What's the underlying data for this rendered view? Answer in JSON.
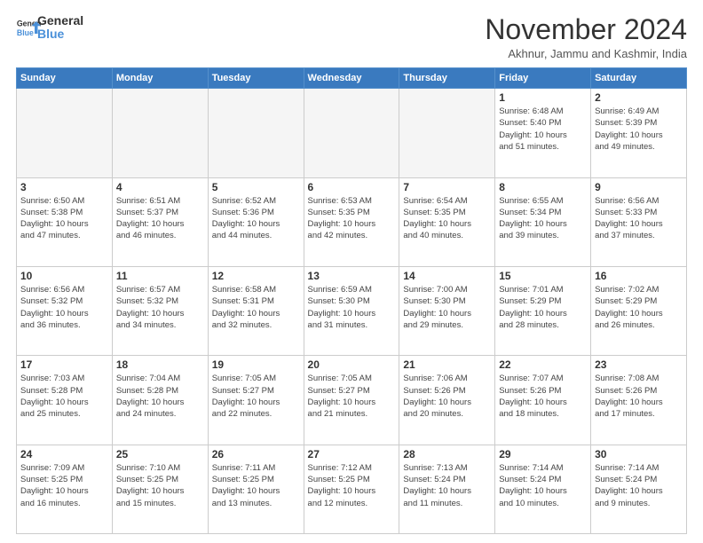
{
  "logo": {
    "line1": "General",
    "line2": "Blue"
  },
  "title": "November 2024",
  "subtitle": "Akhnur, Jammu and Kashmir, India",
  "days_of_week": [
    "Sunday",
    "Monday",
    "Tuesday",
    "Wednesday",
    "Thursday",
    "Friday",
    "Saturday"
  ],
  "weeks": [
    [
      {
        "day": "",
        "info": ""
      },
      {
        "day": "",
        "info": ""
      },
      {
        "day": "",
        "info": ""
      },
      {
        "day": "",
        "info": ""
      },
      {
        "day": "",
        "info": ""
      },
      {
        "day": "1",
        "info": "Sunrise: 6:48 AM\nSunset: 5:40 PM\nDaylight: 10 hours\nand 51 minutes."
      },
      {
        "day": "2",
        "info": "Sunrise: 6:49 AM\nSunset: 5:39 PM\nDaylight: 10 hours\nand 49 minutes."
      }
    ],
    [
      {
        "day": "3",
        "info": "Sunrise: 6:50 AM\nSunset: 5:38 PM\nDaylight: 10 hours\nand 47 minutes."
      },
      {
        "day": "4",
        "info": "Sunrise: 6:51 AM\nSunset: 5:37 PM\nDaylight: 10 hours\nand 46 minutes."
      },
      {
        "day": "5",
        "info": "Sunrise: 6:52 AM\nSunset: 5:36 PM\nDaylight: 10 hours\nand 44 minutes."
      },
      {
        "day": "6",
        "info": "Sunrise: 6:53 AM\nSunset: 5:35 PM\nDaylight: 10 hours\nand 42 minutes."
      },
      {
        "day": "7",
        "info": "Sunrise: 6:54 AM\nSunset: 5:35 PM\nDaylight: 10 hours\nand 40 minutes."
      },
      {
        "day": "8",
        "info": "Sunrise: 6:55 AM\nSunset: 5:34 PM\nDaylight: 10 hours\nand 39 minutes."
      },
      {
        "day": "9",
        "info": "Sunrise: 6:56 AM\nSunset: 5:33 PM\nDaylight: 10 hours\nand 37 minutes."
      }
    ],
    [
      {
        "day": "10",
        "info": "Sunrise: 6:56 AM\nSunset: 5:32 PM\nDaylight: 10 hours\nand 36 minutes."
      },
      {
        "day": "11",
        "info": "Sunrise: 6:57 AM\nSunset: 5:32 PM\nDaylight: 10 hours\nand 34 minutes."
      },
      {
        "day": "12",
        "info": "Sunrise: 6:58 AM\nSunset: 5:31 PM\nDaylight: 10 hours\nand 32 minutes."
      },
      {
        "day": "13",
        "info": "Sunrise: 6:59 AM\nSunset: 5:30 PM\nDaylight: 10 hours\nand 31 minutes."
      },
      {
        "day": "14",
        "info": "Sunrise: 7:00 AM\nSunset: 5:30 PM\nDaylight: 10 hours\nand 29 minutes."
      },
      {
        "day": "15",
        "info": "Sunrise: 7:01 AM\nSunset: 5:29 PM\nDaylight: 10 hours\nand 28 minutes."
      },
      {
        "day": "16",
        "info": "Sunrise: 7:02 AM\nSunset: 5:29 PM\nDaylight: 10 hours\nand 26 minutes."
      }
    ],
    [
      {
        "day": "17",
        "info": "Sunrise: 7:03 AM\nSunset: 5:28 PM\nDaylight: 10 hours\nand 25 minutes."
      },
      {
        "day": "18",
        "info": "Sunrise: 7:04 AM\nSunset: 5:28 PM\nDaylight: 10 hours\nand 24 minutes."
      },
      {
        "day": "19",
        "info": "Sunrise: 7:05 AM\nSunset: 5:27 PM\nDaylight: 10 hours\nand 22 minutes."
      },
      {
        "day": "20",
        "info": "Sunrise: 7:05 AM\nSunset: 5:27 PM\nDaylight: 10 hours\nand 21 minutes."
      },
      {
        "day": "21",
        "info": "Sunrise: 7:06 AM\nSunset: 5:26 PM\nDaylight: 10 hours\nand 20 minutes."
      },
      {
        "day": "22",
        "info": "Sunrise: 7:07 AM\nSunset: 5:26 PM\nDaylight: 10 hours\nand 18 minutes."
      },
      {
        "day": "23",
        "info": "Sunrise: 7:08 AM\nSunset: 5:26 PM\nDaylight: 10 hours\nand 17 minutes."
      }
    ],
    [
      {
        "day": "24",
        "info": "Sunrise: 7:09 AM\nSunset: 5:25 PM\nDaylight: 10 hours\nand 16 minutes."
      },
      {
        "day": "25",
        "info": "Sunrise: 7:10 AM\nSunset: 5:25 PM\nDaylight: 10 hours\nand 15 minutes."
      },
      {
        "day": "26",
        "info": "Sunrise: 7:11 AM\nSunset: 5:25 PM\nDaylight: 10 hours\nand 13 minutes."
      },
      {
        "day": "27",
        "info": "Sunrise: 7:12 AM\nSunset: 5:25 PM\nDaylight: 10 hours\nand 12 minutes."
      },
      {
        "day": "28",
        "info": "Sunrise: 7:13 AM\nSunset: 5:24 PM\nDaylight: 10 hours\nand 11 minutes."
      },
      {
        "day": "29",
        "info": "Sunrise: 7:14 AM\nSunset: 5:24 PM\nDaylight: 10 hours\nand 10 minutes."
      },
      {
        "day": "30",
        "info": "Sunrise: 7:14 AM\nSunset: 5:24 PM\nDaylight: 10 hours\nand 9 minutes."
      }
    ]
  ]
}
